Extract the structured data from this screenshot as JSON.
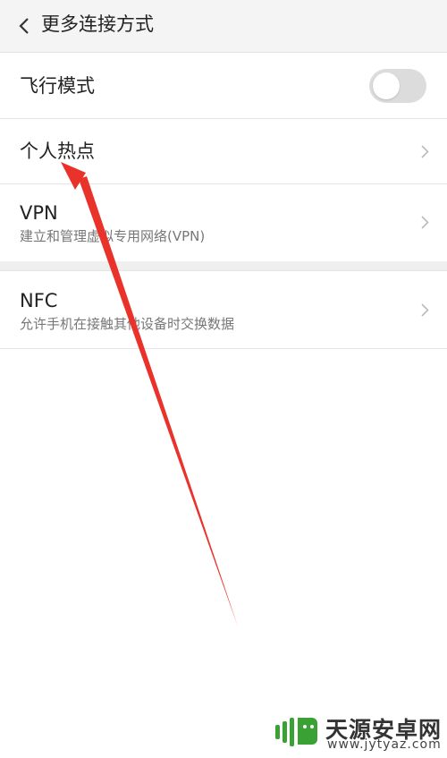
{
  "header": {
    "title": "更多连接方式",
    "back_icon": "chevron-left-icon"
  },
  "rows": {
    "airplane": {
      "label": "飞行模式",
      "toggle_on": false
    },
    "hotspot": {
      "label": "个人热点"
    },
    "vpn": {
      "label": "VPN",
      "subtitle": "建立和管理虚拟专用网络(VPN)"
    },
    "nfc": {
      "label": "NFC",
      "subtitle": "允许手机在接触其他设备时交换数据"
    }
  },
  "colors": {
    "header_bg": "#f4f4f4",
    "toggle_off": "#dcdcdc",
    "annotation_arrow": "#e8322a",
    "watermark_green": "#3aa135"
  },
  "watermark": {
    "text": "天源安卓网",
    "url": "www.jytyaz.com"
  }
}
